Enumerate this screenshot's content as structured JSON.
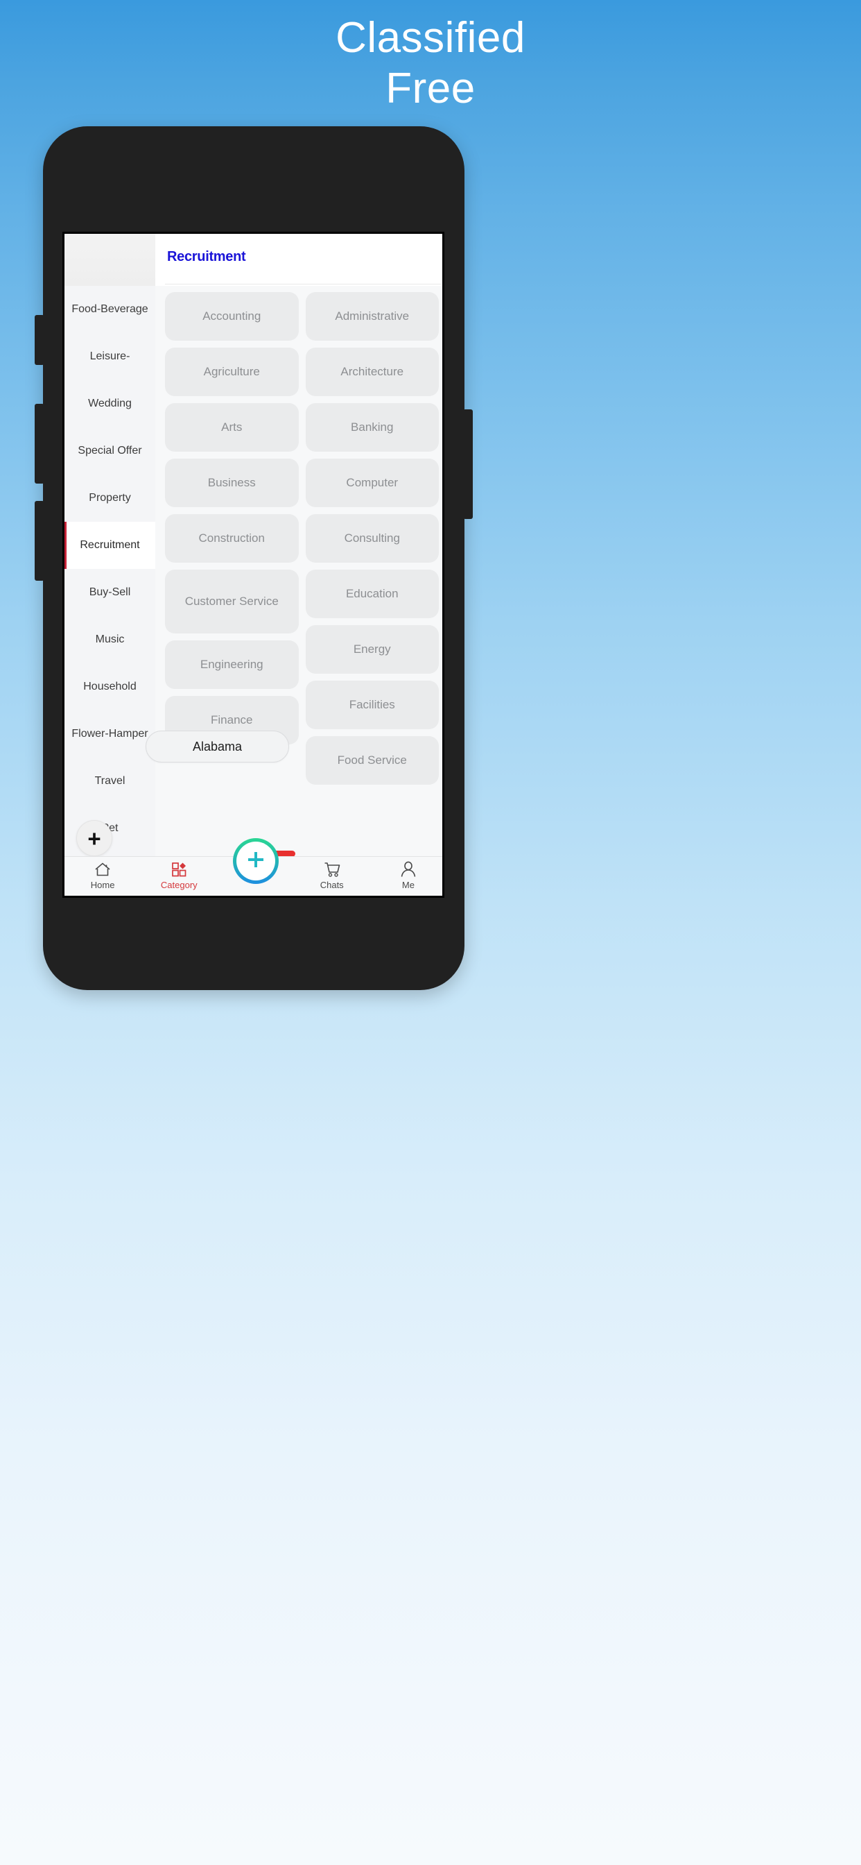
{
  "hero": {
    "line1": "Classified",
    "line2": "Free"
  },
  "appbar": {
    "title": "Recruitment"
  },
  "sidebar": {
    "items": [
      {
        "label": "Food-Beverage",
        "active": false
      },
      {
        "label": "Leisure-",
        "active": false
      },
      {
        "label": "Wedding",
        "active": false
      },
      {
        "label": "Special Offer",
        "active": false
      },
      {
        "label": "Property",
        "active": false
      },
      {
        "label": "Recruitment",
        "active": true
      },
      {
        "label": "Buy-Sell",
        "active": false
      },
      {
        "label": "Music",
        "active": false
      },
      {
        "label": "Household",
        "active": false
      },
      {
        "label": "Flower-Hamper",
        "active": false
      },
      {
        "label": "Travel",
        "active": false
      },
      {
        "label": "Pet",
        "active": false
      }
    ],
    "add_button_label": "+"
  },
  "grid": {
    "left_column": [
      {
        "label": "Accounting",
        "tall": false
      },
      {
        "label": "Agriculture",
        "tall": false
      },
      {
        "label": "Arts",
        "tall": false
      },
      {
        "label": "Business",
        "tall": false
      },
      {
        "label": "Construction",
        "tall": false
      },
      {
        "label": "Customer Service",
        "tall": true
      },
      {
        "label": "Engineering",
        "tall": false
      },
      {
        "label": "Finance",
        "tall": false
      }
    ],
    "right_column": [
      {
        "label": "Administrative",
        "tall": false
      },
      {
        "label": "Architecture",
        "tall": false
      },
      {
        "label": "Banking",
        "tall": false
      },
      {
        "label": "Computer",
        "tall": false
      },
      {
        "label": "Consulting",
        "tall": false
      },
      {
        "label": "Education",
        "tall": false
      },
      {
        "label": "Energy",
        "tall": false
      },
      {
        "label": "Facilities",
        "tall": false
      },
      {
        "label": "Food Service",
        "tall": false
      }
    ]
  },
  "overlays": {
    "location_pill": "Alabama"
  },
  "bottom_nav": {
    "items": [
      {
        "label": "Home",
        "icon": "home-icon",
        "active": false
      },
      {
        "label": "Category",
        "icon": "category-grid-icon",
        "active": true
      },
      {
        "label": "Chats",
        "icon": "cart-icon",
        "active": false
      },
      {
        "label": "Me",
        "icon": "person-icon",
        "active": false
      }
    ],
    "fab_icon": "plus-icon"
  },
  "colors": {
    "accent_red": "#d4383c",
    "title_blue": "#1a14d8",
    "active_marker": "#c62338",
    "fab_gradient_start": "#2bd693",
    "fab_gradient_end": "#1d8ee0",
    "fab_plus": "#22b8c4",
    "background_blue": "#3a9ade"
  }
}
